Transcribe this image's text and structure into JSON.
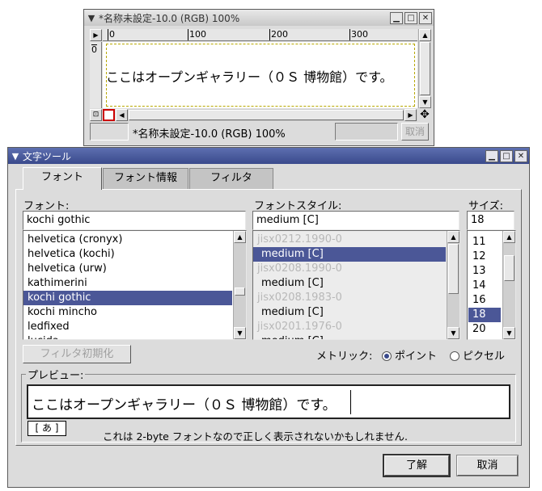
{
  "image_window": {
    "title": "*名称未設定-10.0 (RGB) 100%",
    "ruler_ticks": [
      "0",
      "100",
      "200",
      "300"
    ],
    "ruler_left_tick": "0",
    "canvas_text": "ここはオープンギャラリー（０Ｓ 博物館）です。",
    "status_text": "*名称未設定-10.0 (RGB) 100%",
    "cancel_label": "取消"
  },
  "dialog": {
    "title": "文字ツール",
    "tabs": [
      {
        "label": "フォント"
      },
      {
        "label": "フォント情報"
      },
      {
        "label": "フィルタ"
      }
    ],
    "font": {
      "label": "フォント:",
      "value": "kochi gothic",
      "items": [
        "helvetica (cronyx)",
        "helvetica (kochi)",
        "helvetica (urw)",
        "kathimerini",
        "kochi gothic",
        "kochi mincho",
        "ledfixed",
        "lucida"
      ],
      "selected": "kochi gothic"
    },
    "style": {
      "label": "フォントスタイル:",
      "value": "medium [C]",
      "items": [
        {
          "text": "jisx0212.1990-0",
          "kind": "dis"
        },
        {
          "text": "medium [C]",
          "kind": "sel"
        },
        {
          "text": "jisx0208.1990-0",
          "kind": "dis"
        },
        {
          "text": "medium [C]",
          "kind": ""
        },
        {
          "text": "jisx0208.1983-0",
          "kind": "dis"
        },
        {
          "text": "medium [C]",
          "kind": ""
        },
        {
          "text": "jisx0201.1976-0",
          "kind": "dis"
        },
        {
          "text": "medium [C]",
          "kind": ""
        }
      ]
    },
    "size": {
      "label": "サイズ:",
      "value": "18",
      "items": [
        "11",
        "12",
        "13",
        "14",
        "16",
        "18",
        "20"
      ],
      "selected": "18"
    },
    "reset_filter_label": "フィルタ初期化",
    "metric_label": "メトリック:",
    "metric_point": "ポイント",
    "metric_pixel": "ピクセル",
    "metric_selected": "point",
    "preview_label": "プレビュー:",
    "preview_text": "ここはオープンギャラリー（０Ｓ 博物館）です。",
    "ime_indicator": "[ あ ]",
    "note": "これは 2-byte フォントなので正しく表示されないかもしれません.",
    "ok_label": "了解",
    "cancel_label": "取消"
  },
  "colors": {
    "selection": "#4b5797",
    "dialog_title": "#3a4a8c",
    "window_bg": "#dcdcdc"
  }
}
